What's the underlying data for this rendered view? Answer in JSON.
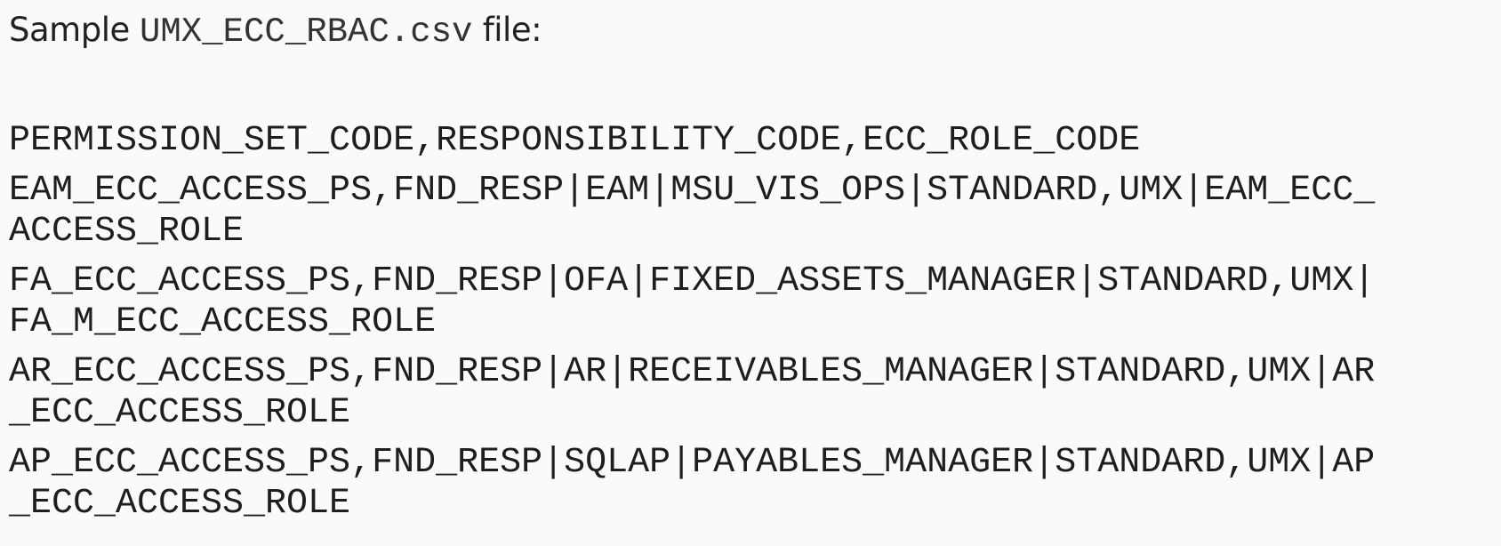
{
  "heading": {
    "prefix": "Sample ",
    "filename": "UMX_ECC_RBAC.csv",
    "suffix": " file:"
  },
  "csv_lines": [
    [
      "PERMISSION_SET_CODE,RESPONSIBILITY_CODE,ECC_ROLE_CODE"
    ],
    [
      "EAM_ECC_ACCESS_PS,FND_RESP|EAM|MSU_VIS_OPS|STANDARD,UMX|EAM_ECC_",
      "ACCESS_ROLE"
    ],
    [
      "FA_ECC_ACCESS_PS,FND_RESP|OFA|FIXED_ASSETS_MANAGER|STANDARD,UMX|",
      "FA_M_ECC_ACCESS_ROLE"
    ],
    [
      "AR_ECC_ACCESS_PS,FND_RESP|AR|RECEIVABLES_MANAGER|STANDARD,UMX|AR",
      "_ECC_ACCESS_ROLE"
    ],
    [
      "AP_ECC_ACCESS_PS,FND_RESP|SQLAP|PAYABLES_MANAGER|STANDARD,UMX|AP",
      "_ECC_ACCESS_ROLE"
    ]
  ]
}
